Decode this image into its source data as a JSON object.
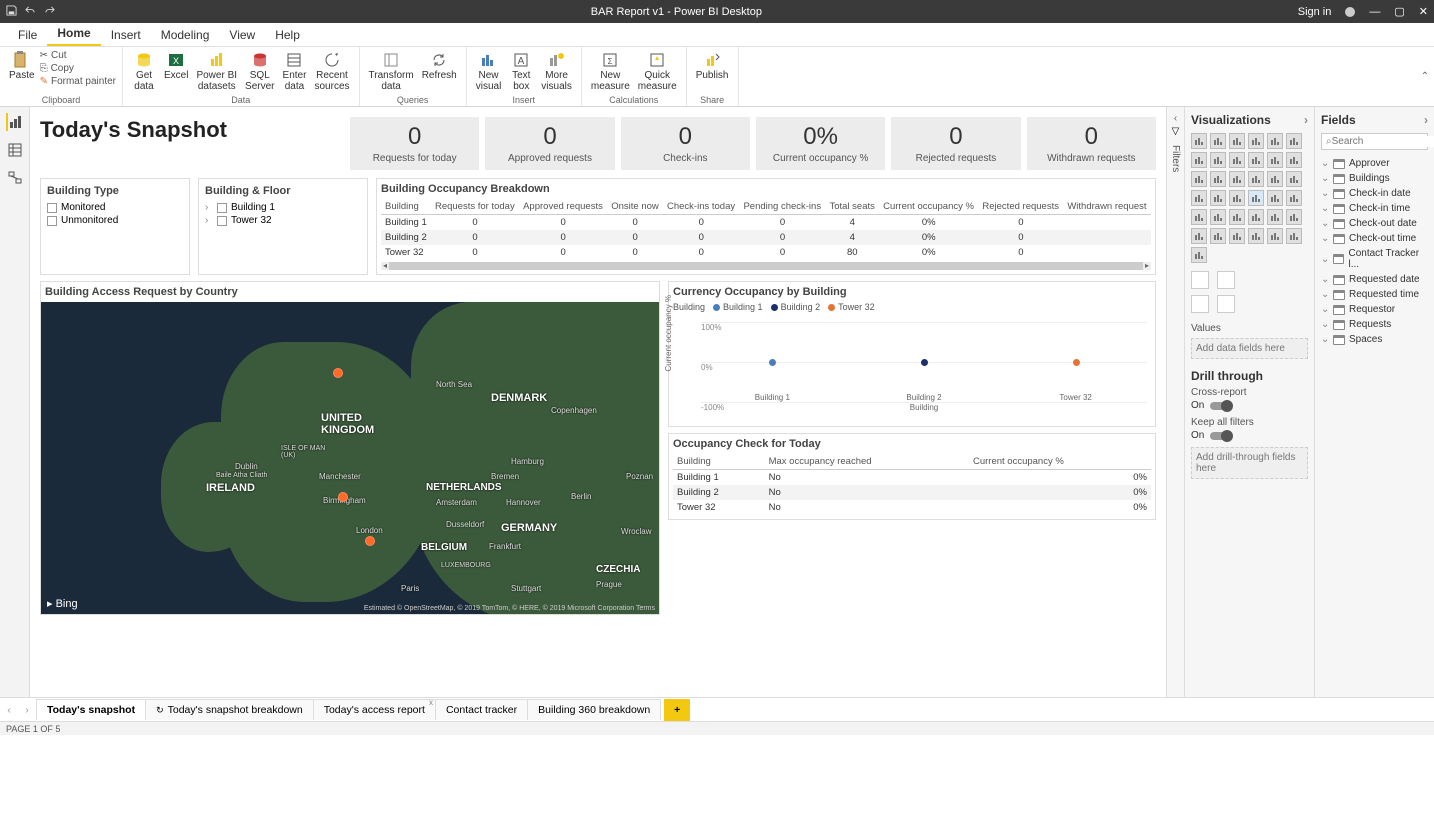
{
  "titlebar": {
    "title": "BAR Report v1 - Power BI Desktop",
    "signin": "Sign in"
  },
  "menutabs": [
    "File",
    "Home",
    "Insert",
    "Modeling",
    "View",
    "Help"
  ],
  "menutabs_active": 1,
  "ribbon": {
    "clipboard": {
      "paste": "Paste",
      "cut": "Cut",
      "copy": "Copy",
      "fmt": "Format painter",
      "label": "Clipboard"
    },
    "data": {
      "get": "Get\ndata",
      "excel": "Excel",
      "pbi": "Power BI\ndatasets",
      "sql": "SQL\nServer",
      "enter": "Enter\ndata",
      "recent": "Recent\nsources",
      "label": "Data"
    },
    "queries": {
      "transform": "Transform\ndata",
      "refresh": "Refresh",
      "label": "Queries"
    },
    "insert": {
      "newv": "New\nvisual",
      "text": "Text\nbox",
      "more": "More\nvisuals",
      "label": "Insert"
    },
    "calc": {
      "newm": "New\nmeasure",
      "quick": "Quick\nmeasure",
      "label": "Calculations"
    },
    "share": {
      "publish": "Publish",
      "label": "Share"
    }
  },
  "filters_label": "Filters",
  "viz": {
    "title": "Visualizations",
    "values": "Values",
    "add_data": "Add data fields here",
    "drill": "Drill through",
    "cross": "Cross-report",
    "on": "On",
    "keep": "Keep all filters",
    "add_drill": "Add drill-through fields here",
    "icon_names": [
      "stacked-bar",
      "stacked-column",
      "clustered-bar",
      "clustered-column",
      "100-bar",
      "100-column",
      "line",
      "area",
      "stacked-area",
      "line-column",
      "line-clustered",
      "ribbon",
      "waterfall",
      "funnel",
      "scatter",
      "pie",
      "donut",
      "treemap",
      "map",
      "filled-map",
      "shape-map",
      "gauge",
      "card",
      "multi-card",
      "kpi",
      "slicer",
      "table",
      "matrix",
      "r",
      "python",
      "key-influencers",
      "decomposition",
      "qa",
      "paginated",
      "arcgis",
      "powerapps",
      "more"
    ]
  },
  "fields": {
    "title": "Fields",
    "search_ph": "Search",
    "tables": [
      "Approver",
      "Buildings",
      "Check-in date",
      "Check-in time",
      "Check-out date",
      "Check-out time",
      "Contact Tracker l...",
      "Requested date",
      "Requested time",
      "Requestor",
      "Requests",
      "Spaces"
    ]
  },
  "snapshot_title": "Today's Snapshot",
  "kpis": [
    {
      "value": "0",
      "label": "Requests for today"
    },
    {
      "value": "0",
      "label": "Approved requests"
    },
    {
      "value": "0",
      "label": "Check-ins"
    },
    {
      "value": "0%",
      "label": "Current occupancy %"
    },
    {
      "value": "0",
      "label": "Rejected requests"
    },
    {
      "value": "0",
      "label": "Withdrawn requests"
    }
  ],
  "slicer1": {
    "title": "Building Type",
    "opts": [
      "Monitored",
      "Unmonitored"
    ]
  },
  "slicer2": {
    "title": "Building & Floor",
    "opts": [
      "Building 1",
      "Tower 32"
    ]
  },
  "bo": {
    "title": "Building Occupancy Breakdown",
    "cols": [
      "Building",
      "Requests for today",
      "Approved requests",
      "Onsite now",
      "Check-ins today",
      "Pending check-ins",
      "Total seats",
      "Current occupancy %",
      "Rejected requests",
      "Withdrawn request"
    ],
    "rows": [
      [
        "Building 1",
        "0",
        "0",
        "0",
        "0",
        "0",
        "4",
        "0%",
        "0",
        ""
      ],
      [
        "Building 2",
        "0",
        "0",
        "0",
        "0",
        "0",
        "4",
        "0%",
        "0",
        ""
      ],
      [
        "Tower 32",
        "0",
        "0",
        "0",
        "0",
        "0",
        "80",
        "0%",
        "0",
        ""
      ]
    ]
  },
  "map_title": "Building Access Request by Country",
  "map": {
    "bing": "Bing",
    "labels": {
      "uk": "UNITED\nKINGDOM",
      "ire": "IRELAND",
      "ger": "GERMANY",
      "nl": "NETHERLANDS",
      "bel": "BELGIUM",
      "den": "DENMARK",
      "cz": "CZECHIA",
      "ns": "North Sea",
      "iom": "ISLE OF MAN\n(UK)",
      "lux": "LUXEMBOURG"
    },
    "cities": [
      "Dublin",
      "Manchester",
      "Birmingham",
      "London",
      "Hamburg",
      "Berlin",
      "Amsterdam",
      "Hannover",
      "Dusseldorf",
      "Frankfurt",
      "Bremen",
      "Copenhagen",
      "Stuttgart",
      "Paris",
      "Prague",
      "Wroclaw",
      "Poznan",
      "Baile Atha Cliath"
    ],
    "attrib": "Estimated © OpenStreetMap, © 2019 TomTom, © HERE, © 2019 Microsoft Corporation Terms"
  },
  "chart_data": {
    "type": "scatter",
    "title": "Currency Occupancy by Building",
    "xlabel": "Building",
    "ylabel": "Current occupancy %",
    "ylim": [
      -100,
      100
    ],
    "yticks": [
      "100%",
      "0%",
      "-100%"
    ],
    "categories": [
      "Building 1",
      "Building 2",
      "Tower 32"
    ],
    "series": [
      {
        "name": "Building 1",
        "color": "#4a7ebb",
        "values": [
          0,
          null,
          null
        ]
      },
      {
        "name": "Building 2",
        "color": "#1c2e6b",
        "values": [
          null,
          0,
          null
        ]
      },
      {
        "name": "Tower 32",
        "color": "#e97132",
        "values": [
          null,
          null,
          0
        ]
      }
    ],
    "legend_title": "Building"
  },
  "oc": {
    "title": "Occupancy Check for Today",
    "cols": [
      "Building",
      "Max occupancy reached",
      "Current occupancy %"
    ],
    "rows": [
      [
        "Building 1",
        "No",
        "0%"
      ],
      [
        "Building 2",
        "No",
        "0%"
      ],
      [
        "Tower 32",
        "No",
        "0%"
      ]
    ]
  },
  "pagetabs": [
    "Today's snapshot",
    "Today's snapshot breakdown",
    "Today's access report",
    "Contact tracker",
    "Building 360 breakdown"
  ],
  "pagetabs_active": 0,
  "status": "PAGE 1 OF 5"
}
